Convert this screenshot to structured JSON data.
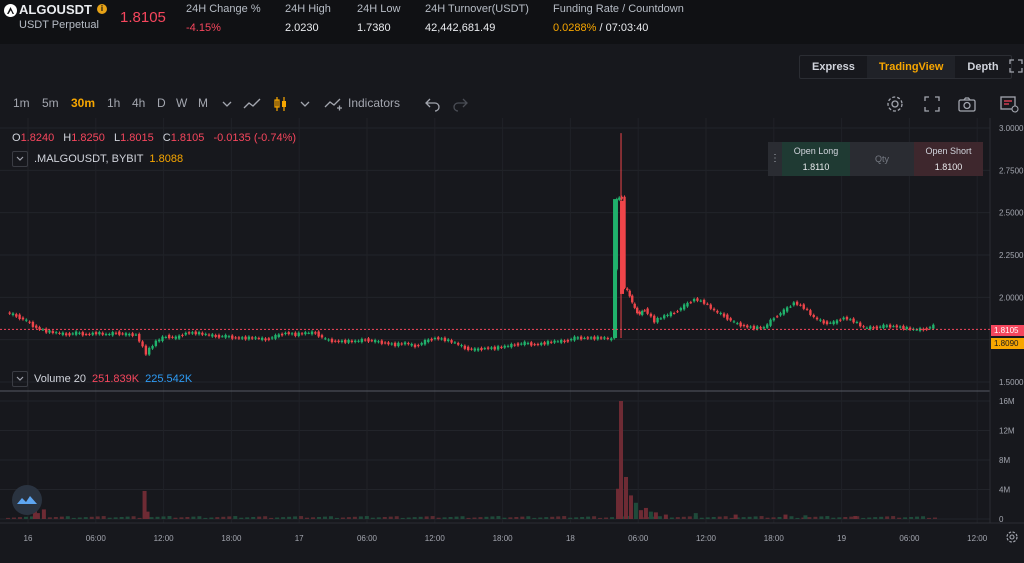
{
  "ticker": {
    "symbol": "ALGOUSDT",
    "contract_type": "USDT Perpetual",
    "last_price": "1.8105",
    "stats": [
      {
        "label": "24H Change %",
        "value": "-4.15%"
      },
      {
        "label": "24H High",
        "value": "2.0230"
      },
      {
        "label": "24H Low",
        "value": "1.7380"
      },
      {
        "label": "24H Turnover(USDT)",
        "value": "42,442,681.49"
      }
    ],
    "funding": {
      "label": "Funding Rate / Countdown",
      "rate": "0.0288%",
      "countdown": " / 07:03:40"
    },
    "info_glyph": "i"
  },
  "views": {
    "items": [
      "Express",
      "TradingView",
      "Depth"
    ],
    "active": "TradingView"
  },
  "toolbar": {
    "timeframes": [
      "1m",
      "5m",
      "30m",
      "1h",
      "4h",
      "D",
      "W",
      "M"
    ],
    "active_timeframe": "30m",
    "indicators_label": "Indicators"
  },
  "legend": {
    "ohlc": [
      {
        "key": "O",
        "value": "1.8240"
      },
      {
        "key": "H",
        "value": "1.8250"
      },
      {
        "key": "L",
        "value": "1.8015"
      },
      {
        "key": "C",
        "value": "1.8105"
      },
      {
        "key": "",
        "value": "-0.0135 (-0.74%)"
      }
    ],
    "series_name": ".MALGOUSDT, BYBIT",
    "series_value": "1.8088",
    "volume_label": "Volume 20",
    "volume_value1": "251.839K",
    "volume_value2": "225.542K"
  },
  "trade": {
    "open_long_label": "Open Long",
    "open_long_price": "1.8110",
    "qty_placeholder": "Qty",
    "open_short_label": "Open Short",
    "open_short_price": "1.8100"
  },
  "price_tags": {
    "last": "1.8105",
    "mark": "1.8090"
  },
  "chart_data": {
    "type": "candlestick",
    "price_axis": {
      "ticks": [
        "3.0000",
        "2.7500",
        "2.5000",
        "2.2500",
        "2.0000",
        "1.5000"
      ],
      "range": [
        1.5,
        3.0
      ]
    },
    "volume_axis": {
      "ticks": [
        "16M",
        "12M",
        "8M",
        "4M",
        "0"
      ],
      "range": [
        0,
        16
      ]
    },
    "time_axis": {
      "ticks": [
        "16",
        "06:00",
        "12:00",
        "18:00",
        "17",
        "06:00",
        "12:00",
        "18:00",
        "18",
        "06:00",
        "12:00",
        "18:00",
        "19",
        "06:00",
        "12:00"
      ]
    },
    "price_path": [
      [
        0,
        1.91
      ],
      [
        10,
        1.89
      ],
      [
        20,
        1.86
      ],
      [
        30,
        1.82
      ],
      [
        40,
        1.8
      ],
      [
        50,
        1.79
      ],
      [
        60,
        1.78
      ],
      [
        70,
        1.79
      ],
      [
        80,
        1.78
      ],
      [
        90,
        1.79
      ],
      [
        100,
        1.78
      ],
      [
        110,
        1.79
      ],
      [
        120,
        1.78
      ],
      [
        130,
        1.78
      ],
      [
        140,
        1.67
      ],
      [
        150,
        1.74
      ],
      [
        160,
        1.77
      ],
      [
        170,
        1.76
      ],
      [
        180,
        1.79
      ],
      [
        190,
        1.79
      ],
      [
        200,
        1.78
      ],
      [
        210,
        1.77
      ],
      [
        220,
        1.77
      ],
      [
        230,
        1.76
      ],
      [
        240,
        1.76
      ],
      [
        250,
        1.76
      ],
      [
        260,
        1.75
      ],
      [
        270,
        1.77
      ],
      [
        280,
        1.79
      ],
      [
        290,
        1.78
      ],
      [
        300,
        1.79
      ],
      [
        310,
        1.79
      ],
      [
        320,
        1.75
      ],
      [
        330,
        1.74
      ],
      [
        340,
        1.74
      ],
      [
        350,
        1.74
      ],
      [
        360,
        1.75
      ],
      [
        370,
        1.74
      ],
      [
        380,
        1.73
      ],
      [
        390,
        1.72
      ],
      [
        400,
        1.73
      ],
      [
        410,
        1.71
      ],
      [
        420,
        1.74
      ],
      [
        430,
        1.76
      ],
      [
        440,
        1.75
      ],
      [
        450,
        1.73
      ],
      [
        460,
        1.7
      ],
      [
        470,
        1.69
      ],
      [
        480,
        1.7
      ],
      [
        490,
        1.7
      ],
      [
        500,
        1.71
      ],
      [
        510,
        1.72
      ],
      [
        520,
        1.73
      ],
      [
        530,
        1.72
      ],
      [
        540,
        1.73
      ],
      [
        550,
        1.74
      ],
      [
        560,
        1.74
      ],
      [
        570,
        1.76
      ],
      [
        580,
        1.76
      ],
      [
        590,
        1.76
      ],
      [
        600,
        1.76
      ],
      [
        607,
        1.75
      ],
      [
        612,
        2.58
      ],
      [
        617,
        2.59
      ],
      [
        620,
        2.06
      ],
      [
        625,
        2.01
      ],
      [
        630,
        1.93
      ],
      [
        635,
        1.9
      ],
      [
        640,
        1.93
      ],
      [
        650,
        1.86
      ],
      [
        660,
        1.89
      ],
      [
        670,
        1.91
      ],
      [
        680,
        1.95
      ],
      [
        690,
        1.99
      ],
      [
        700,
        1.97
      ],
      [
        710,
        1.92
      ],
      [
        720,
        1.89
      ],
      [
        730,
        1.85
      ],
      [
        740,
        1.83
      ],
      [
        750,
        1.82
      ],
      [
        760,
        1.82
      ],
      [
        770,
        1.88
      ],
      [
        780,
        1.92
      ],
      [
        790,
        1.97
      ],
      [
        800,
        1.94
      ],
      [
        810,
        1.88
      ],
      [
        820,
        1.85
      ],
      [
        830,
        1.85
      ],
      [
        840,
        1.88
      ],
      [
        850,
        1.86
      ],
      [
        860,
        1.82
      ],
      [
        870,
        1.82
      ],
      [
        880,
        1.83
      ],
      [
        890,
        1.83
      ],
      [
        900,
        1.82
      ],
      [
        910,
        1.81
      ],
      [
        920,
        1.81
      ],
      [
        930,
        1.83
      ]
    ],
    "volume_bars": [
      [
        27,
        1.5
      ],
      [
        30,
        0.8
      ],
      [
        36,
        1.3
      ],
      [
        137,
        3.8
      ],
      [
        140,
        1.0
      ],
      [
        612,
        4.1
      ],
      [
        615,
        16.0
      ],
      [
        620,
        5.7
      ],
      [
        625,
        3.2
      ],
      [
        630,
        2.2
      ],
      [
        635,
        1.2
      ],
      [
        640,
        1.5
      ],
      [
        645,
        1.0
      ],
      [
        650,
        0.9
      ],
      [
        660,
        0.6
      ],
      [
        690,
        0.8
      ],
      [
        730,
        0.6
      ],
      [
        780,
        0.6
      ],
      [
        800,
        0.5
      ],
      [
        850,
        0.4
      ]
    ],
    "spike_high": 2.97,
    "last_price_line": 1.8105
  }
}
